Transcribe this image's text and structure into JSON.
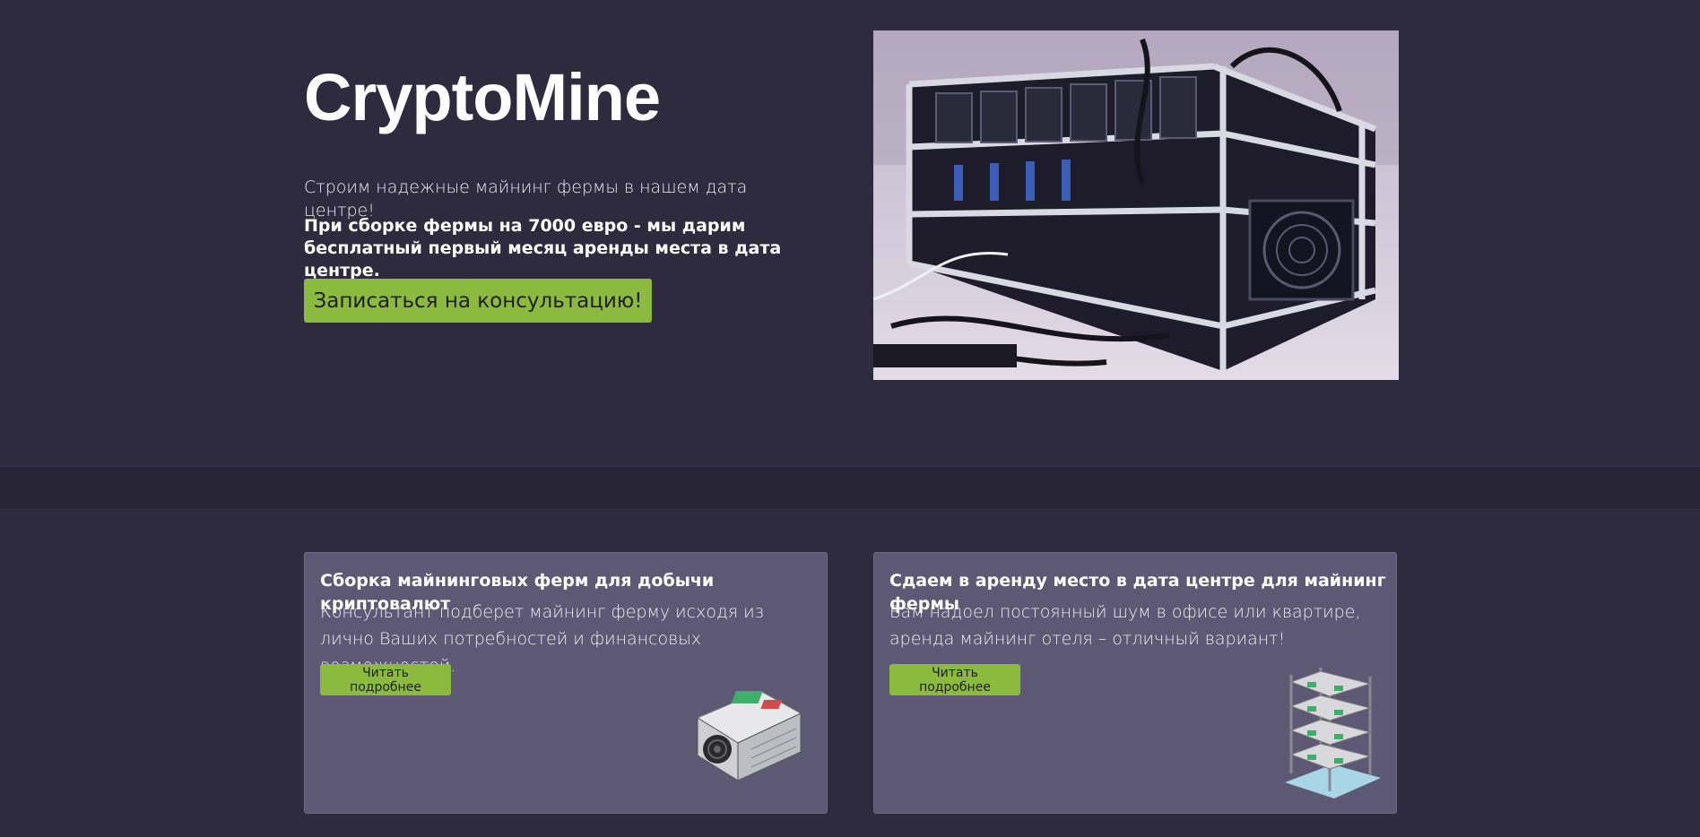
{
  "hero": {
    "brand": "CryptoMine",
    "lead": "Строим надежные майнинг фермы в нашем дата центре!",
    "promo": "При сборке фермы на 7000 евро - мы дарим бесплатный первый месяц аренды места в дата центре.",
    "cta_label": "Записаться на консультацию!",
    "photo_icon": "mining-rig-photo"
  },
  "services": [
    {
      "title": "Сборка майнинговых ферм для добычи криптовалют",
      "text": "Консультант подберет майнинг ферму исходя из лично Ваших потребностей и финансовых возможностей.",
      "button_label": "Читать подробнее",
      "illustration": "asic-miner-icon"
    },
    {
      "title": "Сдаем в аренду место в дата центре для майнинг фермы",
      "text": "Вам надоел постоянный шум в офисе или квартире, аренда майнинг отеля – отличный вариант!",
      "button_label": "Читать подробнее",
      "illustration": "server-rack-icon"
    }
  ],
  "colors": {
    "background": "#2e2b3f",
    "divider": "#272436",
    "card": "#5d5873",
    "accent": "#8cba3f"
  }
}
